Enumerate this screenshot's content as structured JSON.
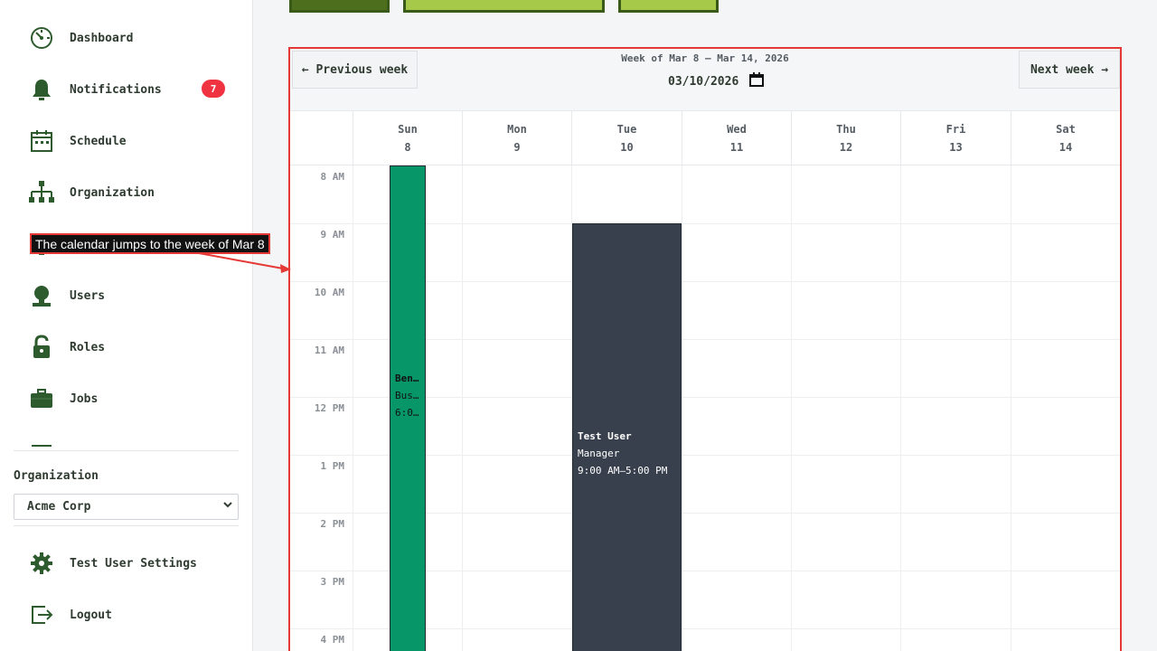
{
  "sidebar": {
    "items": [
      {
        "label": "Dashboard",
        "icon": "dashboard-gauge-icon"
      },
      {
        "label": "Notifications",
        "icon": "bell-icon",
        "badge": "7"
      },
      {
        "label": "Schedule",
        "icon": "calendar-icon"
      },
      {
        "label": "Organization",
        "icon": "org-chart-icon"
      },
      {
        "label": "",
        "icon": "partially-hidden-icon"
      },
      {
        "label": "Users",
        "icon": "user-icon"
      },
      {
        "label": "Roles",
        "icon": "lock-icon"
      },
      {
        "label": "Jobs",
        "icon": "briefcase-icon"
      }
    ],
    "organization_label": "Organization",
    "organization_value": "Acme Corp",
    "settings_label": "Test User Settings",
    "logout_label": "Logout"
  },
  "calendar": {
    "prev_label": "← Previous week",
    "next_label": "Next week →",
    "week_title": "Week of Mar 8 – Mar 14, 2026",
    "date_value": "03/10/2026",
    "days": [
      {
        "name": "Sun",
        "date": "8"
      },
      {
        "name": "Mon",
        "date": "9"
      },
      {
        "name": "Tue",
        "date": "10"
      },
      {
        "name": "Wed",
        "date": "11"
      },
      {
        "name": "Thu",
        "date": "12"
      },
      {
        "name": "Fri",
        "date": "13"
      },
      {
        "name": "Sat",
        "date": "14"
      }
    ],
    "hours": [
      "8 AM",
      "9 AM",
      "10 AM",
      "11 AM",
      "12 PM",
      "1 PM",
      "2 PM",
      "3 PM",
      "4 PM"
    ],
    "events": [
      {
        "day": "Sun",
        "title": "Ben…",
        "subtitle": "Bus…",
        "time": "6:0…",
        "color": "#079667"
      },
      {
        "day": "Tue",
        "title": "Test User",
        "subtitle": "Manager",
        "time": "9:00 AM–5:00 PM",
        "color": "#383f4d"
      }
    ]
  },
  "annotation": {
    "text": "The calendar jumps to the week of Mar 8"
  },
  "colors": {
    "accent": "#e53935",
    "badge": "#ef3340",
    "icon": "#2e5b2e",
    "event_sun": "#079667",
    "event_tue": "#383f4d"
  }
}
